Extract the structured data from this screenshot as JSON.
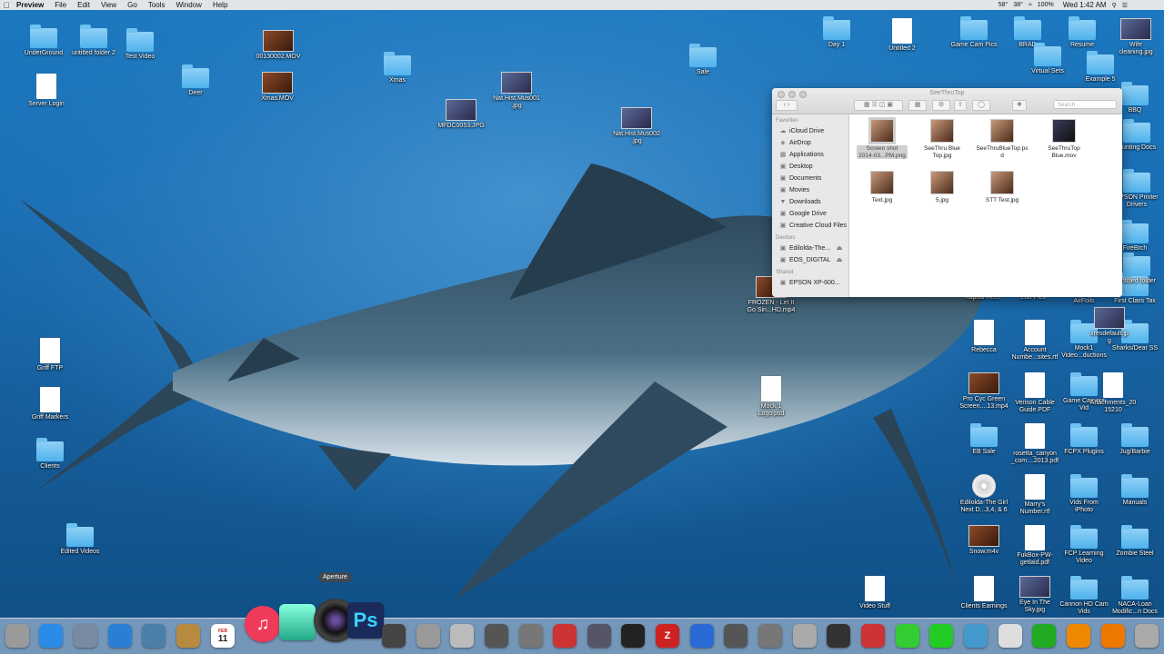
{
  "menubar": {
    "app": "Preview",
    "items": [
      "File",
      "Edit",
      "View",
      "Go",
      "Tools",
      "Window",
      "Help"
    ],
    "status": [
      "58°",
      "38°",
      "100%"
    ],
    "time": "Wed 1:42 AM"
  },
  "desktop_icons": [
    {
      "label": "UnderGround",
      "kind": "folder"
    },
    {
      "label": "untitled folder 2",
      "kind": "folder"
    },
    {
      "label": "Test Video",
      "kind": "folder"
    },
    {
      "label": "00130002.MOV",
      "kind": "video"
    },
    {
      "label": "Xmas.MOV",
      "kind": "video"
    },
    {
      "label": "Server Login",
      "kind": "doc"
    },
    {
      "label": "Deer",
      "kind": "folder"
    },
    {
      "label": "Xmas",
      "kind": "folder"
    },
    {
      "label": "Nat.Hist.Mus001\n.jpg",
      "kind": "image"
    },
    {
      "label": "MFDC0053.JPG",
      "kind": "image"
    },
    {
      "label": "Nat.Hist.Mus002\n.jpg",
      "kind": "image"
    },
    {
      "label": "Sale",
      "kind": "folder"
    },
    {
      "label": "Day 1",
      "kind": "folder"
    },
    {
      "label": "Untitled 2",
      "kind": "doc"
    },
    {
      "label": "Game Cam Pics",
      "kind": "folder"
    },
    {
      "label": "BRAD",
      "kind": "folder"
    },
    {
      "label": "Resume",
      "kind": "folder"
    },
    {
      "label": "Wife\ncleaning.jpg",
      "kind": "image"
    },
    {
      "label": "Virtual Sets",
      "kind": "folder"
    },
    {
      "label": "Griff FTP",
      "kind": "doc"
    },
    {
      "label": "Griff Markers",
      "kind": "doc"
    },
    {
      "label": "Clients",
      "kind": "folder"
    },
    {
      "label": "Edited Videos",
      "kind": "folder"
    },
    {
      "label": "FROZEN - Let It\nGo Sin...HD.mp4",
      "kind": "video"
    },
    {
      "label": "Mock 1\nLogo.psd",
      "kind": "doc"
    },
    {
      "label": "Video Stuff",
      "kind": "doc"
    },
    {
      "label": "Kapital Reef",
      "kind": "folder"
    },
    {
      "label": "Edit Pics",
      "kind": "folder"
    },
    {
      "label": "AirFoils",
      "kind": "folder"
    },
    {
      "label": "First Class Tax",
      "kind": "folder"
    },
    {
      "label": "Rebecca",
      "kind": "doc"
    },
    {
      "label": "Account\nNumbe...sites.rtf",
      "kind": "doc"
    },
    {
      "label": "Mock1\nVideo...ductions",
      "kind": "folder"
    },
    {
      "label": "Sharks/Dear SS",
      "kind": "folder"
    },
    {
      "label": "Pro Cyc Green\nScreen....13.mp4",
      "kind": "video"
    },
    {
      "label": "Verison Cable\nGuide.PDF",
      "kind": "doc"
    },
    {
      "label": "Game Camera\nVid",
      "kind": "folder"
    },
    {
      "label": "Attachments_20\n15210",
      "kind": "doc"
    },
    {
      "label": "EB Sale",
      "kind": "folder"
    },
    {
      "label": "rosetta_canyon\n_com....2013.pdf",
      "kind": "doc"
    },
    {
      "label": "FCPX Plugins",
      "kind": "folder"
    },
    {
      "label": "Jug/Barbie",
      "kind": "folder"
    },
    {
      "label": "Edilolda-The Girl\nNext D...3,4, & 6",
      "kind": "disc"
    },
    {
      "label": "Marry's\nNumber.rtf",
      "kind": "doc"
    },
    {
      "label": "Vids From\niPhoto",
      "kind": "folder"
    },
    {
      "label": "Manuals",
      "kind": "folder"
    },
    {
      "label": "Snow.m4v",
      "kind": "video"
    },
    {
      "label": "FukBox-PW-\ngetlaid.pdf",
      "kind": "doc"
    },
    {
      "label": "FCP Learning\nVideo",
      "kind": "folder"
    },
    {
      "label": "Zombie Steel",
      "kind": "folder"
    },
    {
      "label": "Clients Earnings",
      "kind": "doc"
    },
    {
      "label": "Eye In The\nSky.jpg",
      "kind": "image"
    },
    {
      "label": "Cannon HD Cam\nVids",
      "kind": "folder"
    },
    {
      "label": "NACA-Loan\nModific...n Docs",
      "kind": "folder"
    },
    {
      "label": "EPSON Printer\nDrivers",
      "kind": "folder"
    },
    {
      "label": "Hunting Docs",
      "kind": "folder"
    },
    {
      "label": "BBQ",
      "kind": "folder"
    },
    {
      "label": "FireBrch",
      "kind": "folder"
    },
    {
      "label": "untitled folder",
      "kind": "folder"
    },
    {
      "label": "xresdefault.jp\ng",
      "kind": "image"
    },
    {
      "label": "Example 5",
      "kind": "folder"
    }
  ],
  "finder": {
    "title": "SeeThruTop",
    "search_placeholder": "Search",
    "sections": {
      "favorites": "Favorites",
      "devices": "Devices",
      "shared": "Shared"
    },
    "favorites": [
      "iCloud Drive",
      "AirDrop",
      "Applications",
      "Desktop",
      "Documents",
      "Movies",
      "Downloads",
      "Google Drive",
      "Creative Cloud Files"
    ],
    "devices": [
      "Edilolda-The...",
      "EOS_DIGITAL"
    ],
    "shared": [
      "EPSON XP-600..."
    ],
    "files": [
      {
        "label": "Screen shot\n2014-03...PM.png",
        "selected": true
      },
      {
        "label": "SeeThru Blue\nTop.jpg",
        "selected": false
      },
      {
        "label": "SeeThruBlueTop.ps\nd",
        "selected": false
      },
      {
        "label": "SeeThruTop\nBlue.mov",
        "selected": false
      },
      {
        "label": "Text.jpg",
        "selected": false
      },
      {
        "label": "5.jpg",
        "selected": false
      },
      {
        "label": "STT Test.jpg",
        "selected": false
      }
    ]
  },
  "dock": {
    "tooltip": "Aperture",
    "calendar_month": "FEB",
    "calendar_day": "11",
    "apps": [
      "Finder",
      "App Store",
      "Launchpad",
      "Safari",
      "Preview",
      "Notes",
      "Calendar",
      "iTunes",
      "Image Capture",
      "Aperture",
      "Photoshop",
      "Final Cut Pro",
      "Automator",
      "System Preferences",
      "Motion",
      "Compressor",
      "Photo Booth",
      "iMovie",
      "Terminal",
      "FileZilla",
      "Network",
      "Utility",
      "Directory",
      "Text",
      "Photo",
      "Grid",
      "Messages",
      "FaceTime",
      "Mail",
      "Folder",
      "Numbers",
      "Pages",
      "iBooks",
      "Trash"
    ]
  }
}
